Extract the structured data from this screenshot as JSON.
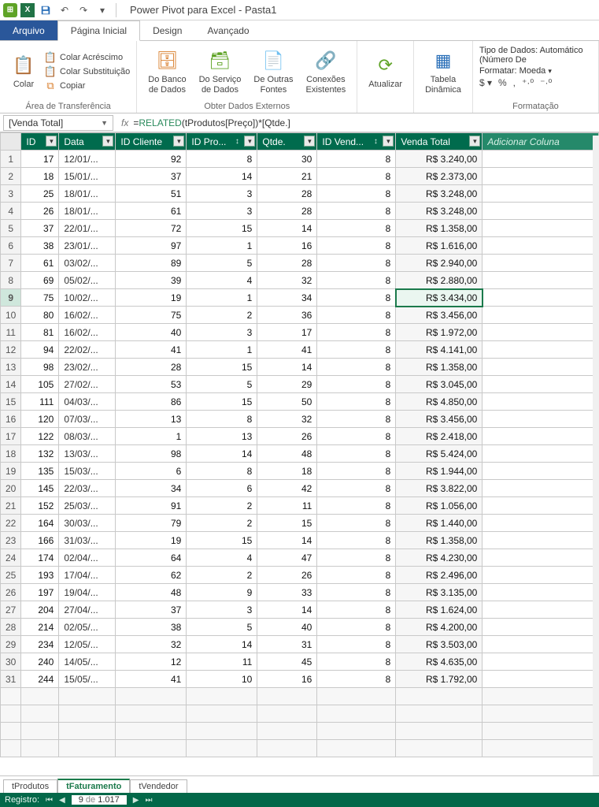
{
  "title": "Power Pivot para Excel - Pasta1",
  "ribbon_tabs": {
    "file": "Arquivo",
    "home": "Página Inicial",
    "design": "Design",
    "advanced": "Avançado"
  },
  "ribbon": {
    "clipboard": {
      "paste": "Colar",
      "paste_append": "Colar Acréscimo",
      "paste_replace": "Colar Substituição",
      "copy": "Copiar",
      "group": "Área de Transferência"
    },
    "external": {
      "from_db": "Do Banco\nde Dados",
      "from_service": "Do Serviço\nde Dados",
      "from_other": "De Outras\nFontes",
      "existing": "Conexões\nExistentes",
      "group": "Obter Dados Externos"
    },
    "refresh": "Atualizar",
    "pivot": "Tabela\nDinâmica",
    "format": {
      "datatype": "Tipo de Dados: Automático (Número De",
      "format": "Formatar: Moeda",
      "group": "Formatação"
    }
  },
  "namebox": "[Venda Total]",
  "formula_prefix": "=",
  "formula_fn": "RELATED",
  "formula_rest": "(tProdutos[Preço])*[Qtde.]",
  "columns": [
    "ID",
    "Data",
    "ID Cliente",
    "ID Pro...",
    "Qtde.",
    "ID Vend...",
    "Venda Total"
  ],
  "add_column": "Adicionar Coluna",
  "rows": [
    {
      "n": 1,
      "id": 17,
      "data": "12/01/...",
      "cli": 92,
      "pro": 8,
      "qtde": 30,
      "vend": 8,
      "total": "R$ 3.240,00"
    },
    {
      "n": 2,
      "id": 18,
      "data": "15/01/...",
      "cli": 37,
      "pro": 14,
      "qtde": 21,
      "vend": 8,
      "total": "R$ 2.373,00"
    },
    {
      "n": 3,
      "id": 25,
      "data": "18/01/...",
      "cli": 51,
      "pro": 3,
      "qtde": 28,
      "vend": 8,
      "total": "R$ 3.248,00"
    },
    {
      "n": 4,
      "id": 26,
      "data": "18/01/...",
      "cli": 61,
      "pro": 3,
      "qtde": 28,
      "vend": 8,
      "total": "R$ 3.248,00"
    },
    {
      "n": 5,
      "id": 37,
      "data": "22/01/...",
      "cli": 72,
      "pro": 15,
      "qtde": 14,
      "vend": 8,
      "total": "R$ 1.358,00"
    },
    {
      "n": 6,
      "id": 38,
      "data": "23/01/...",
      "cli": 97,
      "pro": 1,
      "qtde": 16,
      "vend": 8,
      "total": "R$ 1.616,00"
    },
    {
      "n": 7,
      "id": 61,
      "data": "03/02/...",
      "cli": 89,
      "pro": 5,
      "qtde": 28,
      "vend": 8,
      "total": "R$ 2.940,00"
    },
    {
      "n": 8,
      "id": 69,
      "data": "05/02/...",
      "cli": 39,
      "pro": 4,
      "qtde": 32,
      "vend": 8,
      "total": "R$ 2.880,00"
    },
    {
      "n": 9,
      "id": 75,
      "data": "10/02/...",
      "cli": 19,
      "pro": 1,
      "qtde": 34,
      "vend": 8,
      "total": "R$ 3.434,00",
      "selected": true
    },
    {
      "n": 10,
      "id": 80,
      "data": "16/02/...",
      "cli": 75,
      "pro": 2,
      "qtde": 36,
      "vend": 8,
      "total": "R$ 3.456,00"
    },
    {
      "n": 11,
      "id": 81,
      "data": "16/02/...",
      "cli": 40,
      "pro": 3,
      "qtde": 17,
      "vend": 8,
      "total": "R$ 1.972,00"
    },
    {
      "n": 12,
      "id": 94,
      "data": "22/02/...",
      "cli": 41,
      "pro": 1,
      "qtde": 41,
      "vend": 8,
      "total": "R$ 4.141,00"
    },
    {
      "n": 13,
      "id": 98,
      "data": "23/02/...",
      "cli": 28,
      "pro": 15,
      "qtde": 14,
      "vend": 8,
      "total": "R$ 1.358,00"
    },
    {
      "n": 14,
      "id": 105,
      "data": "27/02/...",
      "cli": 53,
      "pro": 5,
      "qtde": 29,
      "vend": 8,
      "total": "R$ 3.045,00"
    },
    {
      "n": 15,
      "id": 111,
      "data": "04/03/...",
      "cli": 86,
      "pro": 15,
      "qtde": 50,
      "vend": 8,
      "total": "R$ 4.850,00"
    },
    {
      "n": 16,
      "id": 120,
      "data": "07/03/...",
      "cli": 13,
      "pro": 8,
      "qtde": 32,
      "vend": 8,
      "total": "R$ 3.456,00"
    },
    {
      "n": 17,
      "id": 122,
      "data": "08/03/...",
      "cli": 1,
      "pro": 13,
      "qtde": 26,
      "vend": 8,
      "total": "R$ 2.418,00"
    },
    {
      "n": 18,
      "id": 132,
      "data": "13/03/...",
      "cli": 98,
      "pro": 14,
      "qtde": 48,
      "vend": 8,
      "total": "R$ 5.424,00"
    },
    {
      "n": 19,
      "id": 135,
      "data": "15/03/...",
      "cli": 6,
      "pro": 8,
      "qtde": 18,
      "vend": 8,
      "total": "R$ 1.944,00"
    },
    {
      "n": 20,
      "id": 145,
      "data": "22/03/...",
      "cli": 34,
      "pro": 6,
      "qtde": 42,
      "vend": 8,
      "total": "R$ 3.822,00"
    },
    {
      "n": 21,
      "id": 152,
      "data": "25/03/...",
      "cli": 91,
      "pro": 2,
      "qtde": 11,
      "vend": 8,
      "total": "R$ 1.056,00"
    },
    {
      "n": 22,
      "id": 164,
      "data": "30/03/...",
      "cli": 79,
      "pro": 2,
      "qtde": 15,
      "vend": 8,
      "total": "R$ 1.440,00"
    },
    {
      "n": 23,
      "id": 166,
      "data": "31/03/...",
      "cli": 19,
      "pro": 15,
      "qtde": 14,
      "vend": 8,
      "total": "R$ 1.358,00"
    },
    {
      "n": 24,
      "id": 174,
      "data": "02/04/...",
      "cli": 64,
      "pro": 4,
      "qtde": 47,
      "vend": 8,
      "total": "R$ 4.230,00"
    },
    {
      "n": 25,
      "id": 193,
      "data": "17/04/...",
      "cli": 62,
      "pro": 2,
      "qtde": 26,
      "vend": 8,
      "total": "R$ 2.496,00"
    },
    {
      "n": 26,
      "id": 197,
      "data": "19/04/...",
      "cli": 48,
      "pro": 9,
      "qtde": 33,
      "vend": 8,
      "total": "R$ 3.135,00"
    },
    {
      "n": 27,
      "id": 204,
      "data": "27/04/...",
      "cli": 37,
      "pro": 3,
      "qtde": 14,
      "vend": 8,
      "total": "R$ 1.624,00"
    },
    {
      "n": 28,
      "id": 214,
      "data": "02/05/...",
      "cli": 38,
      "pro": 5,
      "qtde": 40,
      "vend": 8,
      "total": "R$ 4.200,00"
    },
    {
      "n": 29,
      "id": 234,
      "data": "12/05/...",
      "cli": 32,
      "pro": 14,
      "qtde": 31,
      "vend": 8,
      "total": "R$ 3.503,00"
    },
    {
      "n": 30,
      "id": 240,
      "data": "14/05/...",
      "cli": 12,
      "pro": 11,
      "qtde": 45,
      "vend": 8,
      "total": "R$ 4.635,00"
    },
    {
      "n": 31,
      "id": 244,
      "data": "15/05/...",
      "cli": 41,
      "pro": 10,
      "qtde": 16,
      "vend": 8,
      "total": "R$ 1.792,00"
    }
  ],
  "sheets": [
    "tProdutos",
    "tFaturamento",
    "tVendedor"
  ],
  "active_sheet": 1,
  "status": {
    "label": "Registro:",
    "current": "9",
    "of_word": "de",
    "total": "1.017"
  }
}
